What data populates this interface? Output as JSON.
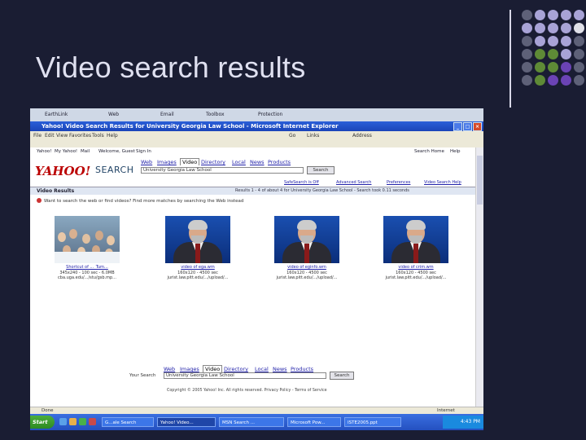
{
  "slide": {
    "title": "Video search results",
    "dot_colors": {
      "lavender": "#a8a3d6",
      "gray": "#5e6178",
      "green": "#5e8a36",
      "purple": "#6b43b5",
      "white": "#e0e0e8"
    }
  },
  "browser": {
    "toolbar1": {
      "earthlink": "EarthLink",
      "web": "Web",
      "email": "Email",
      "toolbox": "Toolbox",
      "protection": "Protection"
    },
    "window_title": "Yahoo! Video Search Results for University Georgia Law School - Microsoft Internet Explorer",
    "menu": [
      "File",
      "Edit",
      "View",
      "Favorites",
      "Tools",
      "Help"
    ],
    "nav": {
      "go": "Go",
      "links": "Links",
      "address": "Address"
    }
  },
  "page": {
    "toplinks": [
      "Yahoo!",
      "My Yahoo!",
      "Mail",
      "Welcome, Guest",
      "Sign In",
      "Search Home",
      "Help"
    ],
    "logo": "YAHOO!",
    "search_word": "SEARCH",
    "tabs": [
      "Web",
      "Images",
      "Video",
      "Directory",
      "Local",
      "News",
      "Products"
    ],
    "active_tab": "Video",
    "query": "University Georgia Law School",
    "search_button": "Search",
    "sublinks": [
      "SafeSearch is Off",
      "Advanced Search",
      "Preferences",
      "Video Search Help"
    ],
    "results_label": "Video Results",
    "results_summary": "Results 1 - 4 of about 4 for University Georgia Law School - Search took 0.11 seconds",
    "also_try": "Want to search the web or find videos? Find more matches by searching the Web instead",
    "thumbs": [
      {
        "title": "Shortcut of ..._Tum...",
        "meta": "345x240 - 100 sec - 6.0MB",
        "url": "cba.uga.edu/.../stu/gsb.mp..."
      },
      {
        "title": "video of ega.wm",
        "meta": "160x120 - 4500 sec",
        "url": "jurist.law.pitt.edu/.../upload/..."
      },
      {
        "title": "video of eginfo.wm",
        "meta": "160x120 - 4500 sec",
        "url": "jurist.law.pitt.edu/.../upload/..."
      },
      {
        "title": "video of crim.wm",
        "meta": "160x120 - 4500 sec",
        "url": "jurist.law.pitt.edu/.../upload/..."
      }
    ],
    "bottom_tabs": [
      "Web",
      "Images",
      "Video",
      "Directory",
      "Local",
      "News",
      "Products"
    ],
    "bottom_label": "Your Search",
    "bottom_query": "University Georgia Law School",
    "bottom_button": "Search",
    "copyright": "Copyright © 2005 Yahoo! Inc. All rights reserved. Privacy Policy - Terms of Service"
  },
  "status": {
    "left": "Done",
    "right": "Internet"
  },
  "taskbar": {
    "start": "Start",
    "tasks": [
      "G...ale Search",
      "Yahoo! Video...",
      "MSN Search ...",
      "Microsoft Pow...",
      "ISTE2005.ppt"
    ],
    "clock": "4:43 PM"
  }
}
